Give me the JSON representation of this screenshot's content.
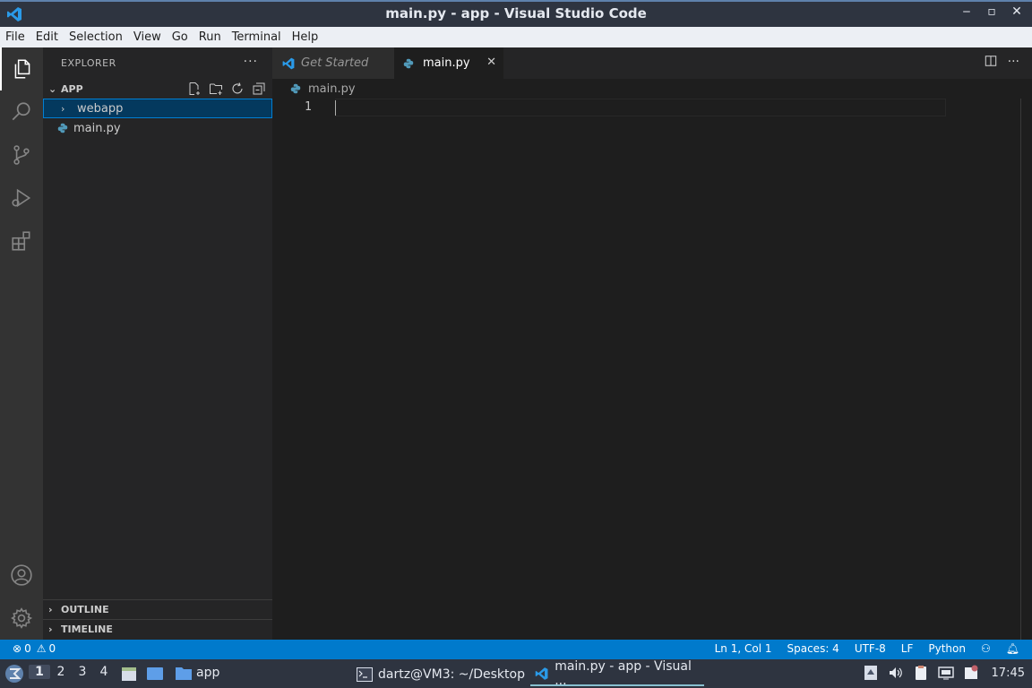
{
  "window": {
    "title": "main.py - app - Visual Studio Code",
    "controls": [
      "minimize",
      "maximize",
      "close"
    ]
  },
  "menu": [
    "File",
    "Edit",
    "Selection",
    "View",
    "Go",
    "Run",
    "Terminal",
    "Help"
  ],
  "activity_bar": [
    "explorer-icon",
    "search-icon",
    "source-control-icon",
    "run-debug-icon",
    "extensions-icon",
    "account-icon",
    "settings-gear-icon"
  ],
  "sidebar": {
    "header": "EXPLORER",
    "more": "···",
    "folder": "APP",
    "tree": [
      {
        "label": "webapp",
        "type": "folder",
        "selected": true
      },
      {
        "label": "main.py",
        "type": "python-file",
        "selected": false
      }
    ],
    "sections": [
      "OUTLINE",
      "TIMELINE"
    ]
  },
  "tabs": [
    {
      "label": "Get Started",
      "active": false
    },
    {
      "label": "main.py",
      "active": true
    }
  ],
  "breadcrumb": "main.py",
  "editor": {
    "line_numbers": [
      "1"
    ]
  },
  "statusbar": {
    "errors": "0",
    "warnings": "0",
    "position": "Ln 1, Col 1",
    "spaces": "Spaces: 4",
    "encoding": "UTF-8",
    "eol": "LF",
    "language": "Python"
  },
  "taskbar": {
    "workspaces": [
      "1",
      "2",
      "3",
      "4"
    ],
    "active_workspace": "1",
    "folder_app": "app",
    "tasks": [
      {
        "label": "dartz@VM3: ~/Desktop",
        "active": false
      },
      {
        "label": "main.py - app - Visual ...",
        "active": true
      }
    ],
    "clock": "17:45"
  },
  "colors": {
    "accent": "#007acc",
    "selection": "#04395e",
    "python_icon": "#519aba"
  }
}
